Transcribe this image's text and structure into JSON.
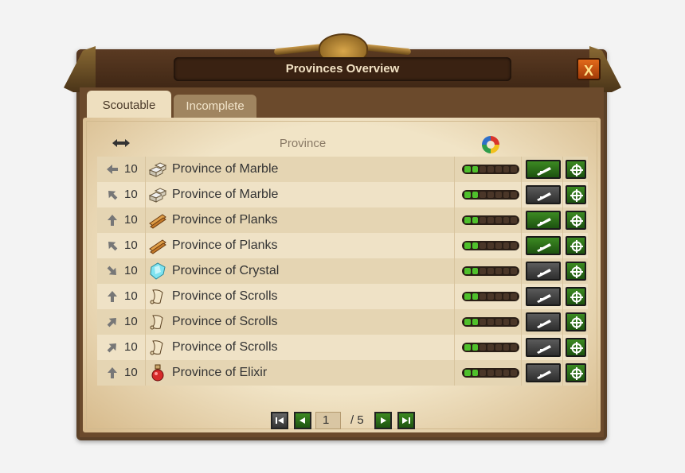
{
  "window": {
    "title": "Provinces Overview",
    "close_label": "X"
  },
  "tabs": [
    {
      "label": "Scoutable",
      "active": true
    },
    {
      "label": "Incomplete",
      "active": false
    }
  ],
  "table": {
    "header_province": "Province",
    "rows": [
      {
        "direction": "west",
        "distance": "10",
        "good_icon": "marble-icon",
        "name": "Province of Marble",
        "progress": 2,
        "segments": 7,
        "scout_ready": true
      },
      {
        "direction": "northwest",
        "distance": "10",
        "good_icon": "marble-icon",
        "name": "Province of Marble",
        "progress": 2,
        "segments": 7,
        "scout_ready": false
      },
      {
        "direction": "north",
        "distance": "10",
        "good_icon": "planks-icon",
        "name": "Province of Planks",
        "progress": 2,
        "segments": 7,
        "scout_ready": true
      },
      {
        "direction": "northwest",
        "distance": "10",
        "good_icon": "planks-icon",
        "name": "Province of Planks",
        "progress": 2,
        "segments": 7,
        "scout_ready": true
      },
      {
        "direction": "southeast",
        "distance": "10",
        "good_icon": "crystal-icon",
        "name": "Province of Crystal",
        "progress": 2,
        "segments": 7,
        "scout_ready": false
      },
      {
        "direction": "north",
        "distance": "10",
        "good_icon": "scrolls-icon",
        "name": "Province of Scrolls",
        "progress": 2,
        "segments": 7,
        "scout_ready": false
      },
      {
        "direction": "northeast",
        "distance": "10",
        "good_icon": "scrolls-icon",
        "name": "Province of Scrolls",
        "progress": 2,
        "segments": 7,
        "scout_ready": false
      },
      {
        "direction": "northeast",
        "distance": "10",
        "good_icon": "scrolls-icon",
        "name": "Province of Scrolls",
        "progress": 2,
        "segments": 7,
        "scout_ready": false
      },
      {
        "direction": "north",
        "distance": "10",
        "good_icon": "elixir-icon",
        "name": "Province of Elixir",
        "progress": 2,
        "segments": 7,
        "scout_ready": false
      }
    ]
  },
  "pagination": {
    "current": "1",
    "total": "/ 5"
  },
  "colors": {
    "accent_green": "#3c8a22",
    "progress_green": "#4fc02c",
    "close_orange": "#e26a1a"
  }
}
